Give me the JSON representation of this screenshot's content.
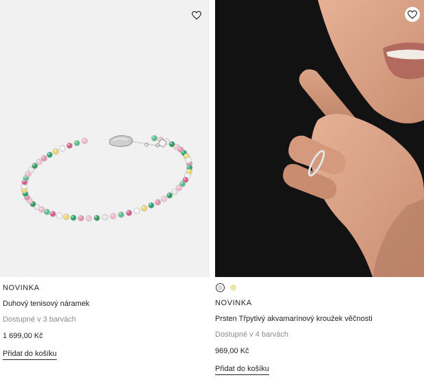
{
  "products": [
    {
      "tag": "NOVINKA",
      "name": "Duhový tenisový náramek",
      "availability": "Dostupné v 3 barvách",
      "price": "1 699,00 Kč",
      "add_to_cart": "Přidat do košíku",
      "wishlist_icon": "heart-icon"
    },
    {
      "tag": "NOVINKA",
      "name": "Prsten Třpytivý akvamarínový kroužek věčnosti",
      "availability": "Dostupné v 4 barvách",
      "price": "969,00 Kč",
      "add_to_cart": "Přidat do košíku",
      "wishlist_icon": "heart-icon",
      "swatches": [
        {
          "name": "silver",
          "color": "#d6d6d6",
          "selected": true
        },
        {
          "name": "gold",
          "color": "#ece5a8",
          "selected": false
        }
      ]
    }
  ]
}
